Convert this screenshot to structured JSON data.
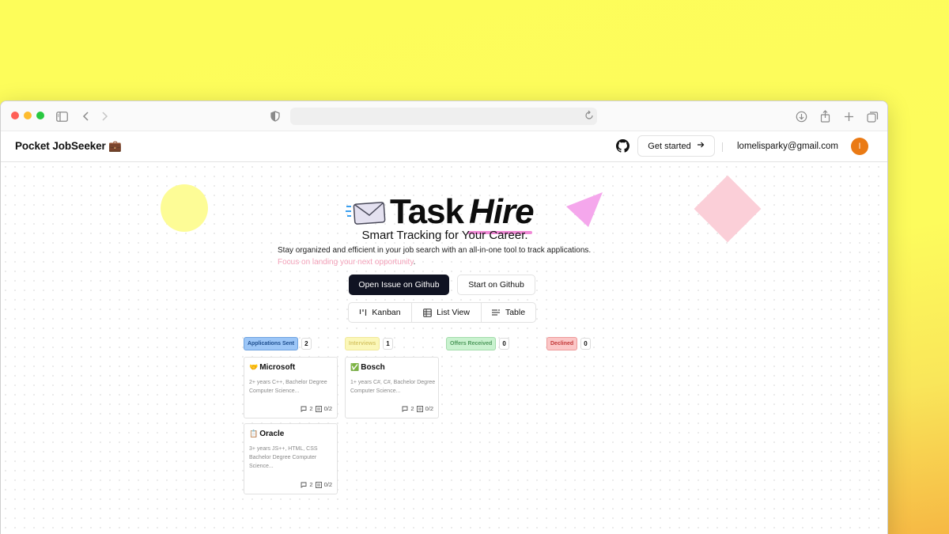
{
  "browser": {
    "url": ""
  },
  "app": {
    "brand": "Pocket JobSeeker 💼",
    "get_started_label": "Get started",
    "email": "lomelisparky@gmail.com",
    "avatar_initial": "l"
  },
  "hero": {
    "logo_task": "Task",
    "logo_hire": "Hire",
    "tagline": "Smart Tracking for Your Career.",
    "desc_main": "Stay organized and efficient in your job search with an all-in-one tool to track applications. ",
    "desc_highlight": "Focus on landing your next opportunity",
    "desc_end": ".",
    "primary_button": "Open Issue on Github",
    "secondary_button": "Start on Github"
  },
  "view_tabs": [
    {
      "label": "Kanban",
      "icon": "kanban-icon"
    },
    {
      "label": "List View",
      "icon": "grid-icon"
    },
    {
      "label": "Table",
      "icon": "table-icon"
    }
  ],
  "board": {
    "columns": [
      {
        "label": "Applications Sent",
        "count": "2",
        "color": "#9cc6f7",
        "text_color": "#1f4f8f"
      },
      {
        "label": "Interviews",
        "count": "1",
        "color": "#fbf7b8",
        "text_color": "#d8c86a"
      },
      {
        "label": "Offers Received",
        "count": "0",
        "color": "#c9f2cf",
        "text_color": "#4f9a5d"
      },
      {
        "label": "Declined",
        "count": "0",
        "color": "#fbc6c6",
        "text_color": "#c33a3a"
      }
    ],
    "cards": [
      {
        "emoji": "🤝",
        "title": "Microsoft",
        "desc": "2+ years C++, Bachelor Degree Computer Science...",
        "comments": "2",
        "tasks": "0/2"
      },
      {
        "emoji": "✅",
        "title": "Bosch",
        "desc": "1+ years C#, C#, Bachelor Degree Computer Science...",
        "comments": "2",
        "tasks": "0/2"
      },
      {
        "emoji": "📋",
        "title": "Oracle",
        "desc": "3+ years JS++, HTML, CSS Bachelor Degree Computer Science...",
        "comments": "2",
        "tasks": "0/2"
      }
    ]
  },
  "colors": {
    "background": "#fdfd5a",
    "accent_pink": "#f08ad6",
    "dark_button": "#101322",
    "avatar": "#ea7a14"
  }
}
